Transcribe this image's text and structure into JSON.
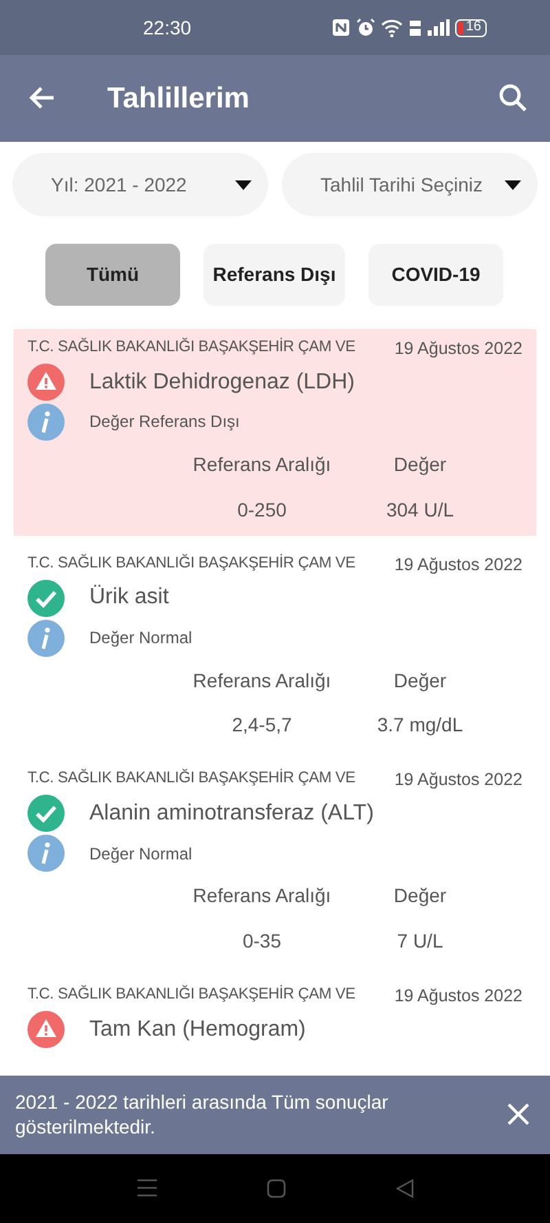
{
  "status_bar": {
    "time": "22:30",
    "battery": "16"
  },
  "app_bar": {
    "title": "Tahlillerim"
  },
  "filters": [
    {
      "label": "Yıl: 2021 - 2022"
    },
    {
      "label": "Tahlil Tarihi Seçiniz"
    }
  ],
  "tabs": [
    {
      "label": "Tümü",
      "selected": true
    },
    {
      "label": "Referans Dışı",
      "selected": false
    },
    {
      "label": "COVID-19",
      "selected": false
    }
  ],
  "results": [
    {
      "institution": "T.C. SAĞLIK BAKANLIĞI BAŞAKŞEHİR ÇAM VE",
      "date": "19 Ağustos 2022",
      "test": "Laktik Dehidrogenaz (LDH)",
      "out_of_range": true,
      "note": "Değer Referans Dışı",
      "range_label": "Referans Aralığı",
      "value_label": "Değer",
      "range": "0-250",
      "value": "304 U/L"
    },
    {
      "institution": "T.C. SAĞLIK BAKANLIĞI BAŞAKŞEHİR ÇAM VE",
      "date": "19 Ağustos 2022",
      "test": "Ürik asit",
      "out_of_range": false,
      "note": "Değer Normal",
      "range_label": "Referans Aralığı",
      "value_label": "Değer",
      "range": "2,4-5,7",
      "value": "3.7 mg/dL"
    },
    {
      "institution": "T.C. SAĞLIK BAKANLIĞI BAŞAKŞEHİR ÇAM VE",
      "date": "19 Ağustos 2022",
      "test": "Alanin aminotransferaz (ALT)",
      "out_of_range": false,
      "note": "Değer Normal",
      "range_label": "Referans Aralığı",
      "value_label": "Değer",
      "range": "0-35",
      "value": "7 U/L"
    },
    {
      "institution": "T.C. SAĞLIK BAKANLIĞI BAŞAKŞEHİR ÇAM VE",
      "date": "19 Ağustos 2022",
      "test": "Tam Kan (Hemogram)",
      "out_of_range": true
    }
  ],
  "snackbar": {
    "message": "2021 - 2022 tarihleri arasında Tüm sonuçlar gösterilmektedir."
  }
}
